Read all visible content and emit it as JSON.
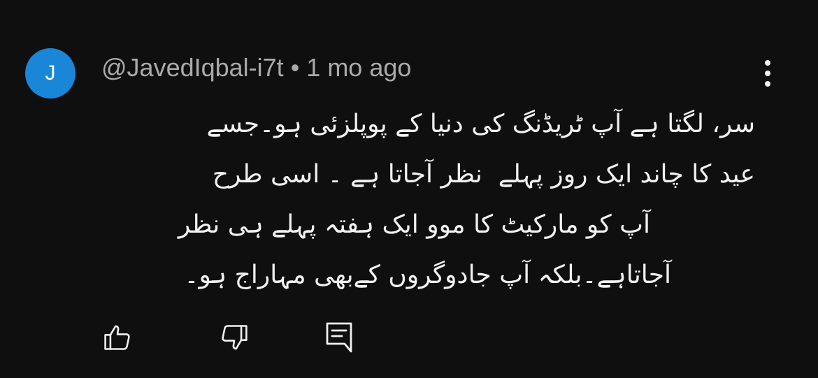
{
  "comment": {
    "avatar_initial": "J",
    "author": "@JavedIqbal-i7t",
    "separator": "•",
    "timestamp": "1 mo ago",
    "text_lines": [
      "سر، لگتا ہے آپ ٹریڈنگ کی دنیا کے پوپلزئی ہو۔جسے",
      "عید کا چاند ایک روز پہلے  نظر آجاتا ہے ۔ اسی طرح",
      "آپ کو مارکیٹ کا موو ایک ہفتہ پہلے ہی نظر",
      "آجاتاہے۔بلکہ آپ جادوگروں کےبھی مہاراج ہو۔"
    ]
  },
  "colors": {
    "background": "#0f0f0f",
    "avatar": "#1a86d8",
    "meta_text": "#aaaaaa",
    "body_text": "#f1f1f1"
  },
  "icons": {
    "more": "vertical-dots-icon",
    "like": "thumbs-up-icon",
    "dislike": "thumbs-down-icon",
    "reply": "reply-comment-icon"
  }
}
